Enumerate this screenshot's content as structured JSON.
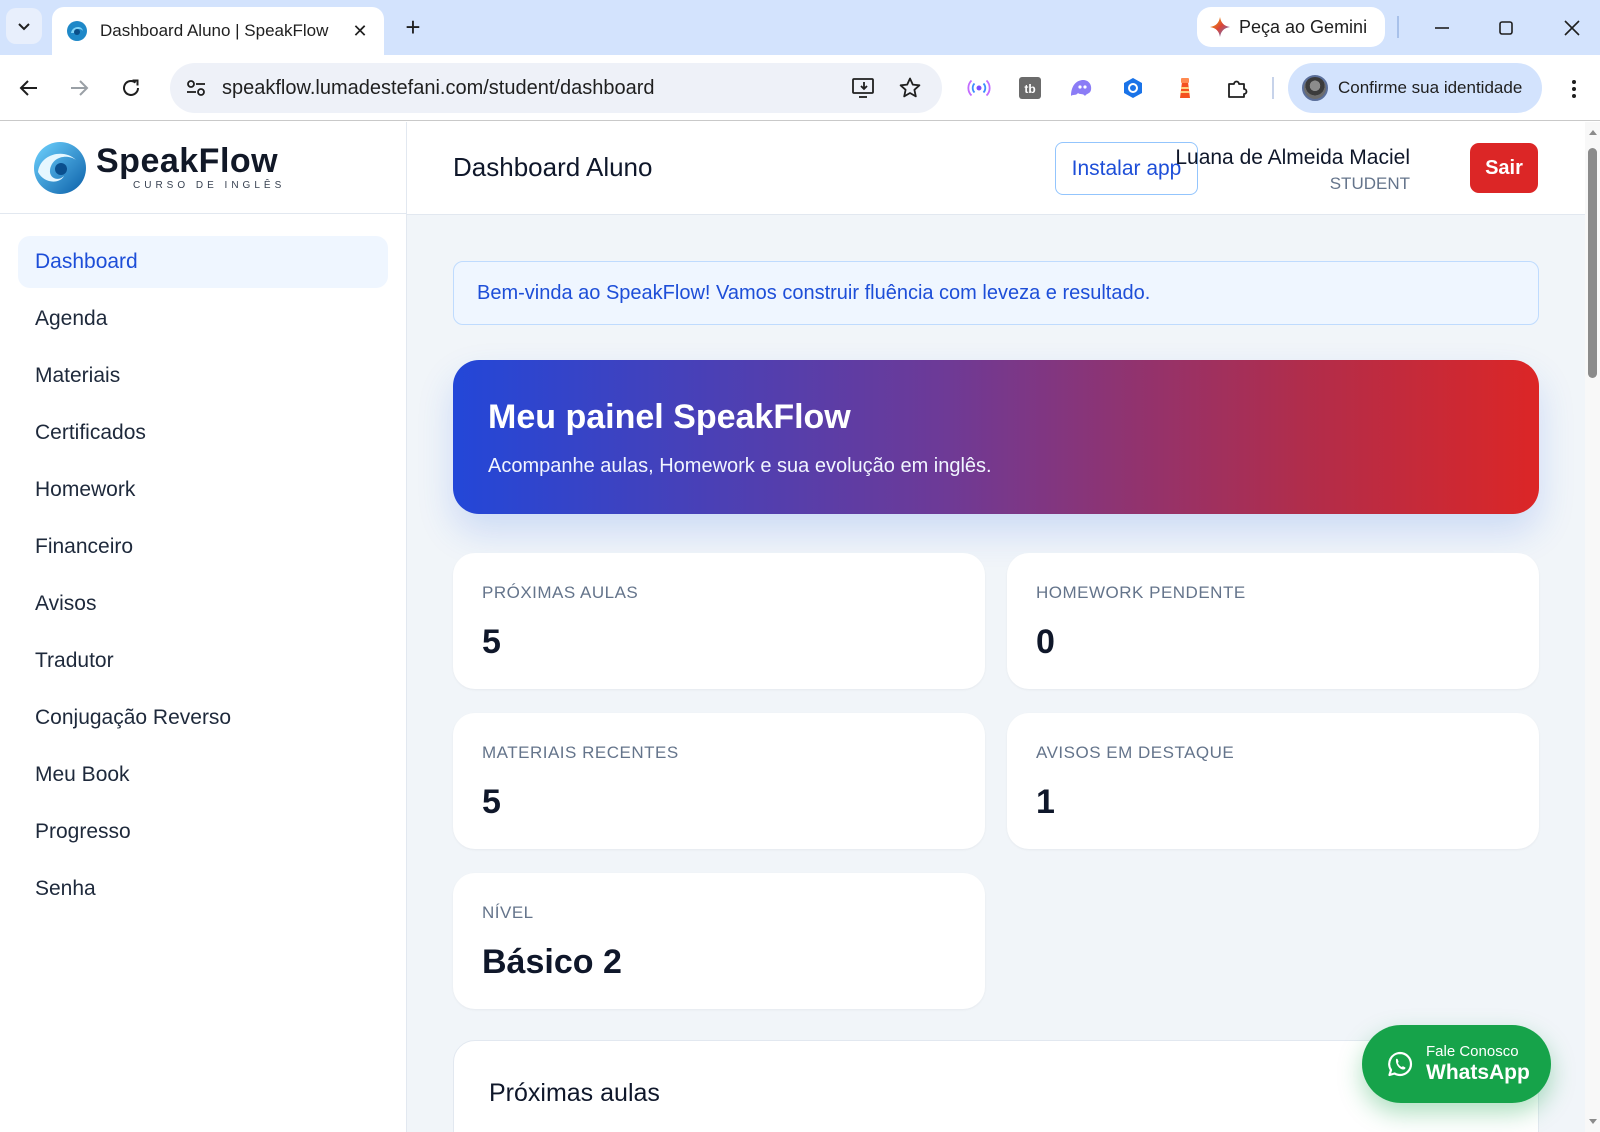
{
  "browser": {
    "tab_title": "Dashboard Aluno | SpeakFlow",
    "tab_close": "✕",
    "new_tab": "+",
    "gemini_label": "Peça ao Gemini",
    "url": "speakflow.lumadestefani.com/student/dashboard",
    "profile_label": "Confirme sua identidade"
  },
  "brand": {
    "name": "SpeakFlow",
    "tagline": "CURSO DE INGLÊS"
  },
  "sidebar": {
    "items": [
      {
        "label": "Dashboard",
        "active": true
      },
      {
        "label": "Agenda"
      },
      {
        "label": "Materiais"
      },
      {
        "label": "Certificados"
      },
      {
        "label": "Homework"
      },
      {
        "label": "Financeiro"
      },
      {
        "label": "Avisos"
      },
      {
        "label": "Tradutor"
      },
      {
        "label": "Conjugação Reverso"
      },
      {
        "label": "Meu Book"
      },
      {
        "label": "Progresso"
      },
      {
        "label": "Senha"
      }
    ]
  },
  "header": {
    "title": "Dashboard Aluno",
    "install_label": "Instalar app",
    "user_name": "Luana de Almeida Maciel",
    "user_role": "STUDENT",
    "logout_label": "Sair"
  },
  "welcome": {
    "text": "Bem-vinda ao SpeakFlow! Vamos construir fluência com leveza e resultado."
  },
  "hero": {
    "title": "Meu painel SpeakFlow",
    "subtitle": "Acompanhe aulas, Homework e sua evolução em inglês."
  },
  "stats": [
    {
      "label": "PRÓXIMAS AULAS",
      "value": "5"
    },
    {
      "label": "HOMEWORK PENDENTE",
      "value": "0"
    },
    {
      "label": "MATERIAIS RECENTES",
      "value": "5"
    },
    {
      "label": "AVISOS EM DESTAQUE",
      "value": "1"
    },
    {
      "label": "NÍVEL",
      "value": "Básico 2"
    }
  ],
  "upcoming": {
    "title": "Próximas aulas"
  },
  "whatsapp": {
    "small": "Fale Conosco",
    "big": "WhatsApp"
  },
  "colors": {
    "accent": "#1d4ed8",
    "danger": "#dc2626",
    "whatsapp": "#16a34a",
    "hero_start": "#2347d8",
    "hero_end": "#dc2626"
  }
}
